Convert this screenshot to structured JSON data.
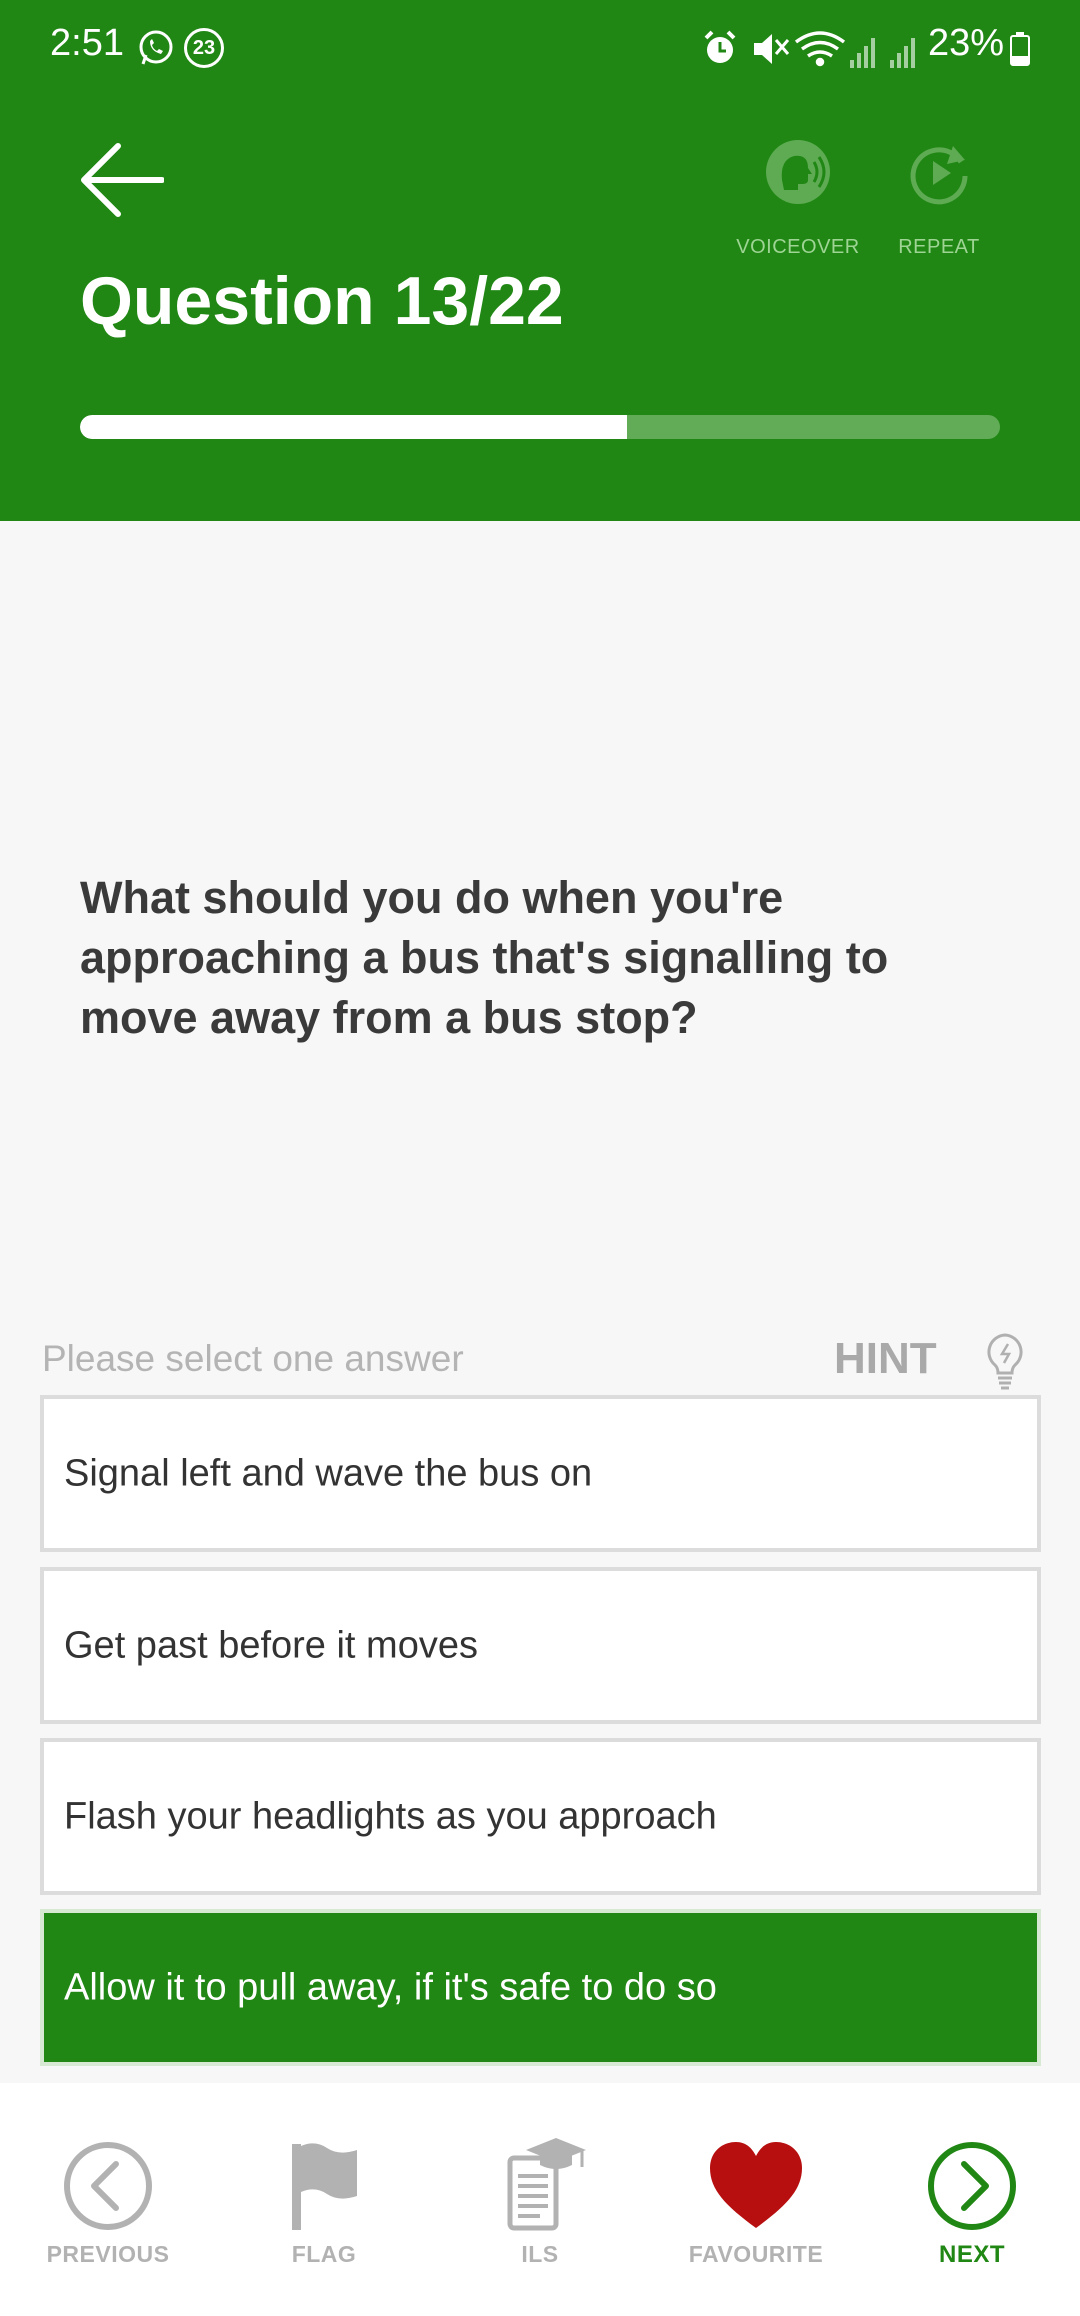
{
  "status_bar": {
    "time": "2:51",
    "notification_count": "23",
    "battery_percent": "23%"
  },
  "header": {
    "title": "Question 13/22",
    "progress": 0.595,
    "voiceover_label": "VOICEOVER",
    "repeat_label": "REPEAT"
  },
  "question": {
    "text": "What should you do when you're approaching a bus that's signalling to move away from a bus stop?"
  },
  "answers": {
    "instruction": "Please select one answer",
    "hint_label": "HINT",
    "options": [
      {
        "label": "Signal left and wave the bus on",
        "selected": false
      },
      {
        "label": "Get past before it moves",
        "selected": false
      },
      {
        "label": "Flash your headlights as you approach",
        "selected": false
      },
      {
        "label": "Allow it to pull away, if it's safe to do so",
        "selected": true
      }
    ]
  },
  "bottom_nav": {
    "items": [
      {
        "label": "PREVIOUS",
        "icon": "chevron-left-circle-icon"
      },
      {
        "label": "FLAG",
        "icon": "flag-icon"
      },
      {
        "label": "ILS",
        "icon": "ils-book-icon"
      },
      {
        "label": "FAVOURITE",
        "icon": "heart-icon"
      },
      {
        "label": "NEXT",
        "icon": "chevron-right-circle-icon"
      }
    ]
  },
  "colors": {
    "brand_green": "#208714",
    "heart_red": "#b70f0f",
    "muted_grey": "#b2b2b2"
  }
}
